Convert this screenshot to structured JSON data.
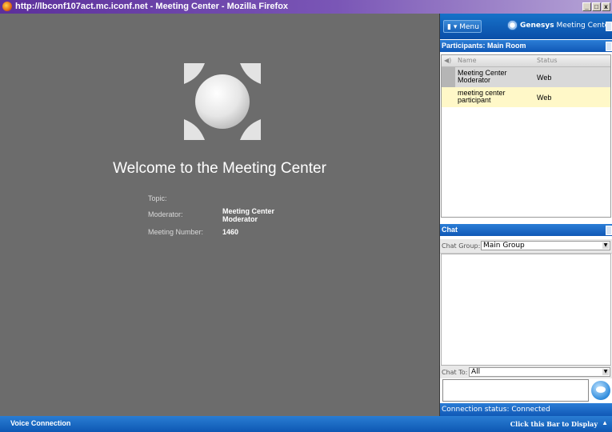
{
  "window": {
    "title": "http://lbconf107act.mc.iconf.net - Meeting Center - Mozilla Firefox",
    "buttons": [
      "_",
      "□",
      "x"
    ]
  },
  "welcome": {
    "heading": "Welcome to the Meeting Center",
    "topic_label": "Topic:",
    "topic_value": "",
    "moderator_label": "Moderator:",
    "moderator_value": "Meeting Center Moderator",
    "meeting_number_label": "Meeting Number:",
    "meeting_number_value": "1460"
  },
  "header": {
    "menu_label": "▮ ▾ Menu",
    "brand": "Genesys",
    "product": " Meeting Center"
  },
  "participants": {
    "title": "Participants: Main Room",
    "columns": {
      "icon": "◀)",
      "name": "Name",
      "status": "Status"
    },
    "rows": [
      {
        "name": "Meeting Center Moderator",
        "status": "Web"
      },
      {
        "name": "meeting center participant",
        "status": "Web"
      }
    ]
  },
  "chat": {
    "title": "Chat",
    "group_label": "Chat Group:",
    "group_value": "Main Group",
    "to_label": "Chat To:",
    "to_value": "All",
    "message_value": ""
  },
  "status": {
    "connection": "Connection status: Connected"
  },
  "bottom_bar": {
    "voice": "Voice Connection",
    "display": "Click this Bar to Display",
    "arrow": "▲"
  },
  "colors": {
    "accent": "#1660bc",
    "moderator_row": "#d9d9d9",
    "participant_row": "#fff8c8",
    "stage": "#6c6c6c"
  },
  "icons": {
    "window": "firefox-icon",
    "logo": "meeting-center-logo",
    "genesys": "genesys-logo-icon",
    "send": "send-chat-icon"
  }
}
